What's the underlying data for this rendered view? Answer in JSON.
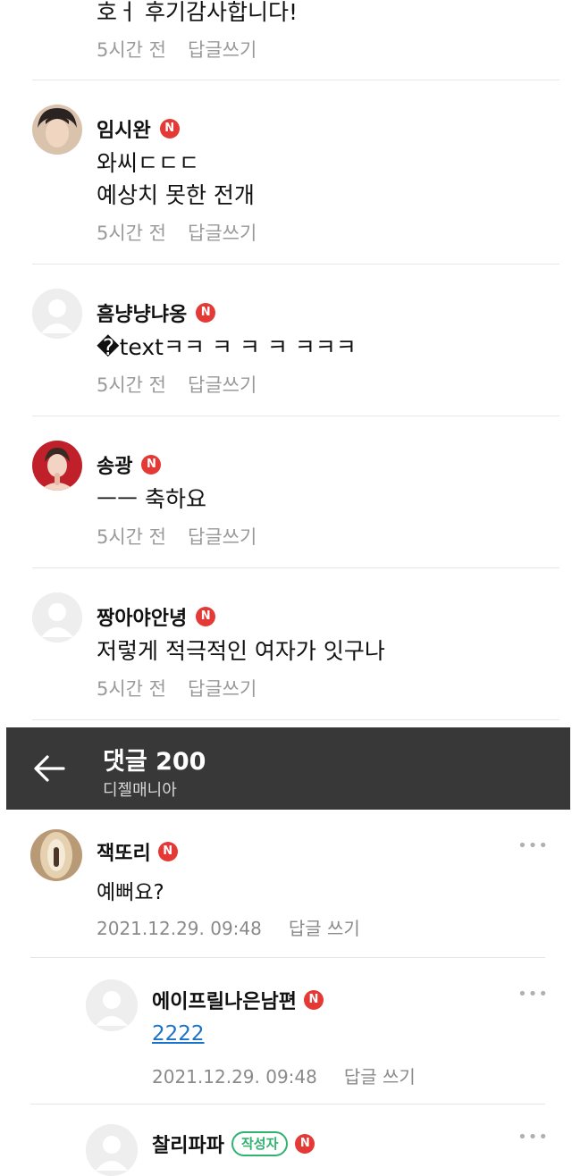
{
  "list_comments": [
    {
      "name": "",
      "text_lines": [
        "호ㅓ 후기감사합니다!"
      ],
      "time": "5시간 전",
      "reply": "답글쓰기"
    },
    {
      "name": "임시완",
      "text_lines": [
        "와씨ㄷㄷㄷ",
        "예상치 못한 전개"
      ],
      "time": "5시간 전",
      "reply": "답글쓰기"
    },
    {
      "name": "흠냥냥냐옹",
      "text_lines": [
        "�textㅋㅋ ㅋ ㅋ ㅋ ㅋㅋㅋ"
      ],
      "time": "5시간 전",
      "reply": "답글쓰기"
    },
    {
      "name": "송광",
      "text_lines": [
        "ㅡㅡ 축하요"
      ],
      "time": "5시간 전",
      "reply": "답글쓰기"
    },
    {
      "name": "짱아야안녕",
      "text_lines": [
        "저렇게 적극적인 여자가 잇구나"
      ],
      "time": "5시간 전",
      "reply": "답글쓰기"
    }
  ],
  "badge_letter": "N",
  "header": {
    "title": "댓글 200",
    "subtitle": "디젤매니아"
  },
  "comments": [
    {
      "name": "잭또리",
      "text": "예뻐요?",
      "time": "2021.12.29. 09:48",
      "reply": "답글 쓰기",
      "more": "•••"
    },
    {
      "name": "에이프릴나은남편",
      "text": "2222",
      "time": "2021.12.29. 09:48",
      "reply": "답글 쓰기",
      "more": "•••"
    },
    {
      "name": "찰리파파",
      "writer_badge": "작성자",
      "more": "•••"
    }
  ],
  "colors": {
    "badge": "#e53935",
    "header_bg": "#383838",
    "link": "#1a73c9",
    "writer_badge": "#2fb36f"
  }
}
